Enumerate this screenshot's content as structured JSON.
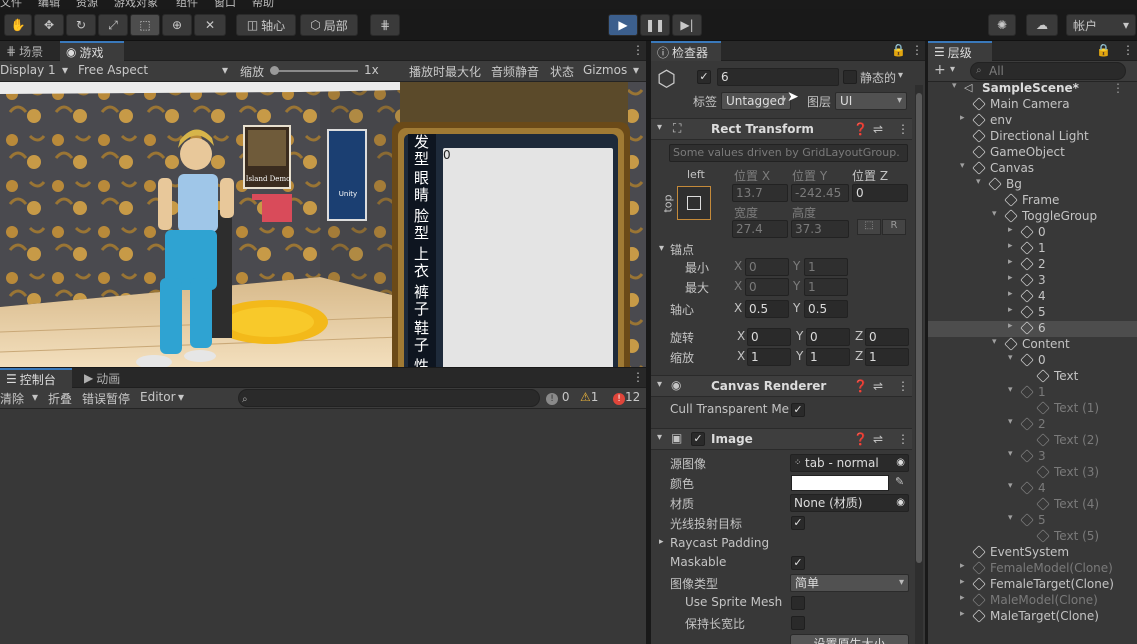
{
  "menu": [
    "文件",
    "编辑",
    "资源",
    "游戏对象",
    "组件",
    "窗口",
    "帮助"
  ],
  "toolbar": {
    "pivot_label": "轴心",
    "local_label": "局部",
    "account_label": "帐户"
  },
  "scene_panel": {
    "tabs": [
      "场景",
      "游戏"
    ],
    "display": "Display 1",
    "aspect": "Free Aspect",
    "scale_label": "缩放",
    "scale_value": "1x",
    "maximize_label": "播放时最大化",
    "mute_label": "音频静音",
    "stats_label": "状态",
    "gizmos_label": "Gizmos",
    "game_sign_1": "Island Demo",
    "game_sign_2": "Unity",
    "categories": [
      "发型",
      "眼睛",
      "脸型",
      "上衣",
      "裤子",
      "鞋子",
      "性别"
    ],
    "content_text": "0"
  },
  "console_panel": {
    "tabs": [
      "控制台",
      "动画"
    ],
    "clear": "清除",
    "collapse": "折叠",
    "error_pause": "错误暂停",
    "editor": "Editor",
    "count_info": "0",
    "count_warn": "1",
    "count_error": "12"
  },
  "inspector": {
    "tab": "检查器",
    "object_name": "6",
    "static_label": "静态的",
    "tag_label": "标签",
    "tag_value": "Untagged",
    "layer_label": "图层",
    "layer_value": "UI",
    "rect_transform": {
      "title": "Rect Transform",
      "note": "Some values driven by GridLayoutGroup.",
      "anchor_h": "left",
      "anchor_v": "top",
      "pos_x_label": "位置 X",
      "pos_y_label": "位置 Y",
      "pos_z_label": "位置 Z",
      "pos_x": "13.7",
      "pos_y": "-242.45",
      "pos_z": "0",
      "width_label": "宽度",
      "height_label": "高度",
      "width": "27.4",
      "height": "37.3",
      "r_label": "R",
      "anchors_label": "锚点",
      "min_label": "最小",
      "max_label": "最大",
      "min_x": "0",
      "min_y": "1",
      "max_x": "0",
      "max_y": "1",
      "pivot_label": "轴心",
      "pivot_x": "0.5",
      "pivot_y": "0.5",
      "rotation_label": "旋转",
      "rot_x": "0",
      "rot_y": "0",
      "rot_z": "0",
      "scale_label": "缩放",
      "scale_x": "1",
      "scale_y": "1",
      "scale_z": "1",
      "axis_x": "X",
      "axis_y": "Y",
      "axis_z": "Z"
    },
    "canvas_renderer": {
      "title": "Canvas Renderer",
      "cull_label": "Cull Transparent Me"
    },
    "image": {
      "title": "Image",
      "source_label": "源图像",
      "source_value": "tab - normal",
      "color_label": "颜色",
      "material_label": "材质",
      "material_value": "None (材质)",
      "raycast_label": "光线投射目标",
      "raycast_padding_label": "Raycast Padding",
      "maskable_label": "Maskable",
      "image_type_label": "图像类型",
      "image_type_value": "简单",
      "use_sprite_mesh_label": "Use Sprite Mesh",
      "preserve_aspect_label": "保持长宽比",
      "native_size_button": "设置原生大小"
    }
  },
  "hierarchy": {
    "tab": "层级",
    "search_placeholder": "All",
    "items": [
      {
        "name": "SampleScene*",
        "depth": 0,
        "arrow": "▾",
        "bold": true,
        "dim": false
      },
      {
        "name": "Main Camera",
        "depth": 1,
        "arrow": "",
        "bold": false,
        "dim": false
      },
      {
        "name": "env",
        "depth": 1,
        "arrow": "▸",
        "bold": false,
        "dim": false
      },
      {
        "name": "Directional Light",
        "depth": 1,
        "arrow": "",
        "bold": false,
        "dim": false
      },
      {
        "name": "GameObject",
        "depth": 1,
        "arrow": "",
        "bold": false,
        "dim": false
      },
      {
        "name": "Canvas",
        "depth": 1,
        "arrow": "▾",
        "bold": false,
        "dim": false
      },
      {
        "name": "Bg",
        "depth": 2,
        "arrow": "▾",
        "bold": false,
        "dim": false
      },
      {
        "name": "Frame",
        "depth": 3,
        "arrow": "",
        "bold": false,
        "dim": false
      },
      {
        "name": "ToggleGroup",
        "depth": 3,
        "arrow": "▾",
        "bold": false,
        "dim": false
      },
      {
        "name": "0",
        "depth": 4,
        "arrow": "▸",
        "bold": false,
        "dim": false
      },
      {
        "name": "1",
        "depth": 4,
        "arrow": "▸",
        "bold": false,
        "dim": false
      },
      {
        "name": "2",
        "depth": 4,
        "arrow": "▸",
        "bold": false,
        "dim": false
      },
      {
        "name": "3",
        "depth": 4,
        "arrow": "▸",
        "bold": false,
        "dim": false
      },
      {
        "name": "4",
        "depth": 4,
        "arrow": "▸",
        "bold": false,
        "dim": false
      },
      {
        "name": "5",
        "depth": 4,
        "arrow": "▸",
        "bold": false,
        "dim": false
      },
      {
        "name": "6",
        "depth": 4,
        "arrow": "▸",
        "bold": false,
        "dim": false,
        "selected": true
      },
      {
        "name": "Content",
        "depth": 3,
        "arrow": "▾",
        "bold": false,
        "dim": false
      },
      {
        "name": "0",
        "depth": 4,
        "arrow": "▾",
        "bold": false,
        "dim": false
      },
      {
        "name": "Text",
        "depth": 5,
        "arrow": "",
        "bold": false,
        "dim": false
      },
      {
        "name": "1",
        "depth": 4,
        "arrow": "▾",
        "bold": false,
        "dim": true
      },
      {
        "name": "Text (1)",
        "depth": 5,
        "arrow": "",
        "bold": false,
        "dim": true
      },
      {
        "name": "2",
        "depth": 4,
        "arrow": "▾",
        "bold": false,
        "dim": true
      },
      {
        "name": "Text (2)",
        "depth": 5,
        "arrow": "",
        "bold": false,
        "dim": true
      },
      {
        "name": "3",
        "depth": 4,
        "arrow": "▾",
        "bold": false,
        "dim": true
      },
      {
        "name": "Text (3)",
        "depth": 5,
        "arrow": "",
        "bold": false,
        "dim": true
      },
      {
        "name": "4",
        "depth": 4,
        "arrow": "▾",
        "bold": false,
        "dim": true
      },
      {
        "name": "Text (4)",
        "depth": 5,
        "arrow": "",
        "bold": false,
        "dim": true
      },
      {
        "name": "5",
        "depth": 4,
        "arrow": "▾",
        "bold": false,
        "dim": true
      },
      {
        "name": "Text (5)",
        "depth": 5,
        "arrow": "",
        "bold": false,
        "dim": true
      },
      {
        "name": "EventSystem",
        "depth": 1,
        "arrow": "",
        "bold": false,
        "dim": false
      },
      {
        "name": "FemaleModel(Clone)",
        "depth": 1,
        "arrow": "▸",
        "bold": false,
        "dim": true
      },
      {
        "name": "FemaleTarget(Clone)",
        "depth": 1,
        "arrow": "▸",
        "bold": false,
        "dim": false
      },
      {
        "name": "MaleModel(Clone)",
        "depth": 1,
        "arrow": "▸",
        "bold": false,
        "dim": true
      },
      {
        "name": "MaleTarget(Clone)",
        "depth": 1,
        "arrow": "▸",
        "bold": false,
        "dim": false
      }
    ]
  },
  "colors": {
    "accent": "#3a79bb",
    "play": "#3c5f8d",
    "selected_row": "#4d4d4d"
  }
}
